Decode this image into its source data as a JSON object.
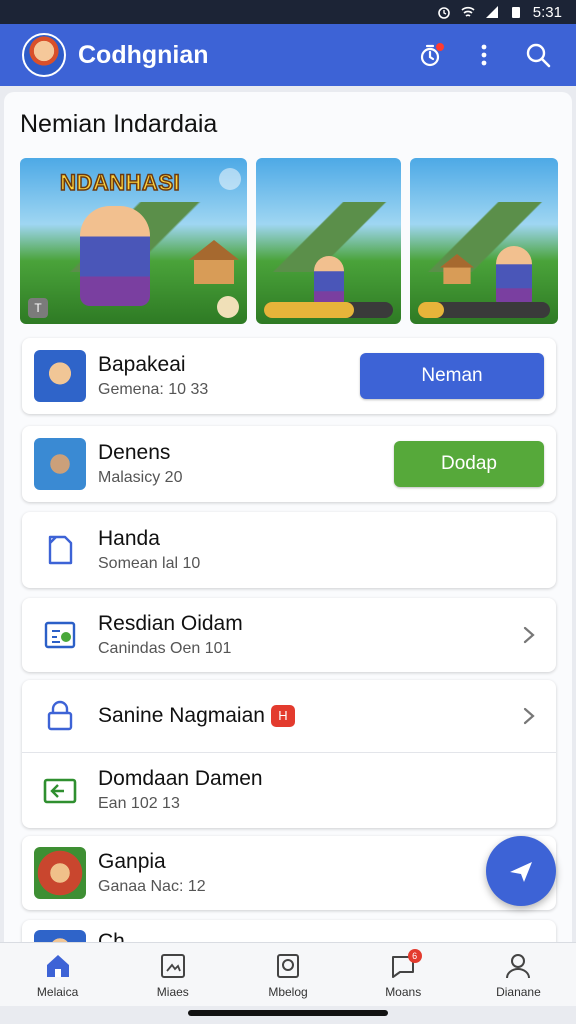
{
  "status_bar": {
    "time": "5:31"
  },
  "app_bar": {
    "title": "Codhgnian",
    "icons": [
      "avatar",
      "timer-icon",
      "more-icon",
      "search-icon"
    ],
    "accent_color": "#3d63d6"
  },
  "section": {
    "title": "Nemian Indardaia"
  },
  "banners": [
    {
      "logo": "NDANHASI"
    },
    {
      "logo": ""
    },
    {
      "logo": ""
    }
  ],
  "list": [
    {
      "title": "Bapakeai",
      "subtitle": "Gemena: 10 33",
      "action": "Neman",
      "action_color": "#3d63d6"
    },
    {
      "title": "Denens",
      "subtitle": "Malasicy 20",
      "action": "Dodap",
      "action_color": "#56a93a"
    },
    {
      "title": "Handa",
      "subtitle": "Somean lal 10"
    },
    {
      "title": "Resdian Oidam",
      "subtitle": "Canindas Oen 101"
    },
    {
      "title": "Sanine Nagmaian",
      "tag": "H"
    },
    {
      "title": "Domdaan Damen",
      "subtitle": "Ean 102 13"
    },
    {
      "title": "Ganpia",
      "subtitle": "Ganaa Nac: 12"
    },
    {
      "title": "Ch"
    }
  ],
  "bottom_nav": [
    {
      "label": "Melaica"
    },
    {
      "label": "Miaes"
    },
    {
      "label": "Mbelog"
    },
    {
      "label": "Moans",
      "badge": "6"
    },
    {
      "label": "Dianane"
    }
  ]
}
